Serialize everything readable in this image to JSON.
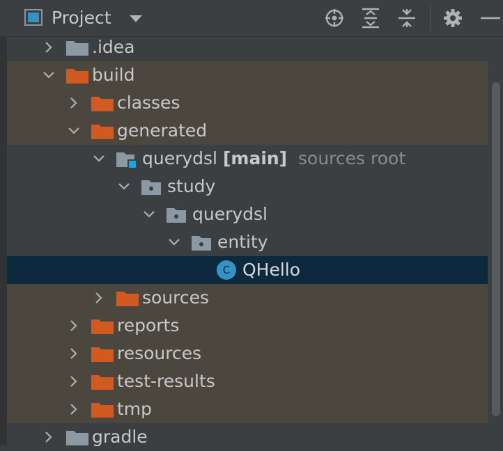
{
  "header": {
    "title": "Project",
    "icons": [
      "project-view-icon",
      "dropdown-chevron-icon",
      "locate-icon",
      "expand-all-icon",
      "collapse-all-icon",
      "gear-icon",
      "hide-icon"
    ]
  },
  "colors": {
    "background": "#3c3f41",
    "highlight_row": "#4b473f",
    "selected_row": "#0d293e",
    "excluded_folder": "#d2591f",
    "normal_folder": "#8c98a4",
    "source_root_badge": "#19a3e0",
    "class_icon": "#3592c4"
  },
  "tree": {
    "items": [
      {
        "label": ".idea",
        "state": "collapsed",
        "type": "folder"
      },
      {
        "label": "build",
        "state": "expanded",
        "type": "excluded-folder"
      },
      {
        "label": "classes",
        "state": "collapsed",
        "type": "excluded-folder"
      },
      {
        "label": "generated",
        "state": "expanded",
        "type": "excluded-folder"
      },
      {
        "label": "querydsl",
        "bold_suffix": "[main]",
        "muted_suffix": "sources root",
        "state": "expanded",
        "type": "source-root-folder"
      },
      {
        "label": "study",
        "state": "expanded",
        "type": "package"
      },
      {
        "label": "querydsl",
        "state": "expanded",
        "type": "package"
      },
      {
        "label": "entity",
        "state": "expanded",
        "type": "package"
      },
      {
        "label": "QHello",
        "type": "class",
        "selected": true,
        "class_letter": "C"
      },
      {
        "label": "sources",
        "state": "collapsed",
        "type": "excluded-folder"
      },
      {
        "label": "reports",
        "state": "collapsed",
        "type": "excluded-folder"
      },
      {
        "label": "resources",
        "state": "collapsed",
        "type": "excluded-folder"
      },
      {
        "label": "test-results",
        "state": "collapsed",
        "type": "excluded-folder"
      },
      {
        "label": "tmp",
        "state": "collapsed",
        "type": "excluded-folder"
      },
      {
        "label": "gradle",
        "state": "collapsed",
        "type": "folder"
      }
    ]
  }
}
